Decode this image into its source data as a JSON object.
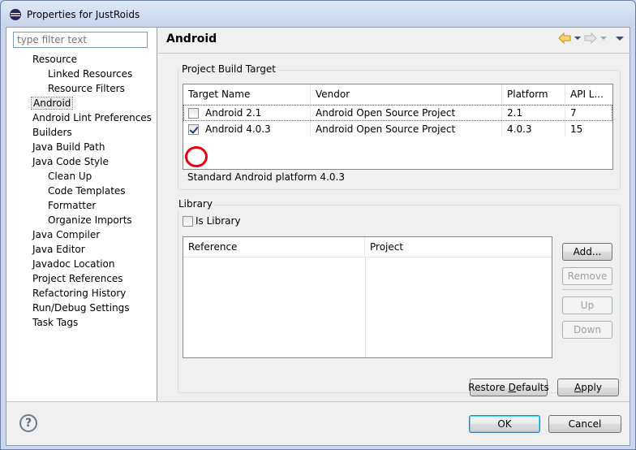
{
  "window": {
    "title": "Properties for JustRoids"
  },
  "filter": {
    "placeholder": "type filter text"
  },
  "tree": [
    {
      "label": "Resource",
      "level": 0
    },
    {
      "label": "Linked Resources",
      "level": 1
    },
    {
      "label": "Resource Filters",
      "level": 1
    },
    {
      "label": "Android",
      "level": 0,
      "selected": true
    },
    {
      "label": "Android Lint Preferences",
      "level": 0
    },
    {
      "label": "Builders",
      "level": 0
    },
    {
      "label": "Java Build Path",
      "level": 0
    },
    {
      "label": "Java Code Style",
      "level": 0
    },
    {
      "label": "Clean Up",
      "level": 1
    },
    {
      "label": "Code Templates",
      "level": 1
    },
    {
      "label": "Formatter",
      "level": 1
    },
    {
      "label": "Organize Imports",
      "level": 1
    },
    {
      "label": "Java Compiler",
      "level": 0
    },
    {
      "label": "Java Editor",
      "level": 0
    },
    {
      "label": "Javadoc Location",
      "level": 0
    },
    {
      "label": "Project References",
      "level": 0
    },
    {
      "label": "Refactoring History",
      "level": 0
    },
    {
      "label": "Run/Debug Settings",
      "level": 0
    },
    {
      "label": "Task Tags",
      "level": 0
    }
  ],
  "page": {
    "title": "Android"
  },
  "build_target": {
    "group_label": "Project Build Target",
    "columns": [
      "Target Name",
      "Vendor",
      "Platform",
      "API L..."
    ],
    "rows": [
      {
        "name": "Android 2.1",
        "vendor": "Android Open Source Project",
        "platform": "2.1",
        "api": "7",
        "checked": false
      },
      {
        "name": "Android 4.0.3",
        "vendor": "Android Open Source Project",
        "platform": "4.0.3",
        "api": "15",
        "checked": true
      }
    ],
    "description": "Standard Android platform 4.0.3"
  },
  "library": {
    "group_label": "Library",
    "is_library_label": "Is Library",
    "is_library_checked": false,
    "columns": [
      "Reference",
      "Project"
    ],
    "add_label": "Add...",
    "remove_label": "Remove",
    "up_label": "Up",
    "down_label": "Down"
  },
  "buttons": {
    "restore_defaults_pre": "Restore ",
    "restore_defaults_ul": "D",
    "restore_defaults_post": "efaults",
    "apply_ul": "A",
    "apply_post": "pply",
    "ok_label": "OK",
    "cancel_label": "Cancel",
    "help_label": "?"
  },
  "colors": {
    "annotation_circle": "#e8000c",
    "title_gradient": "#c9d6ec"
  }
}
